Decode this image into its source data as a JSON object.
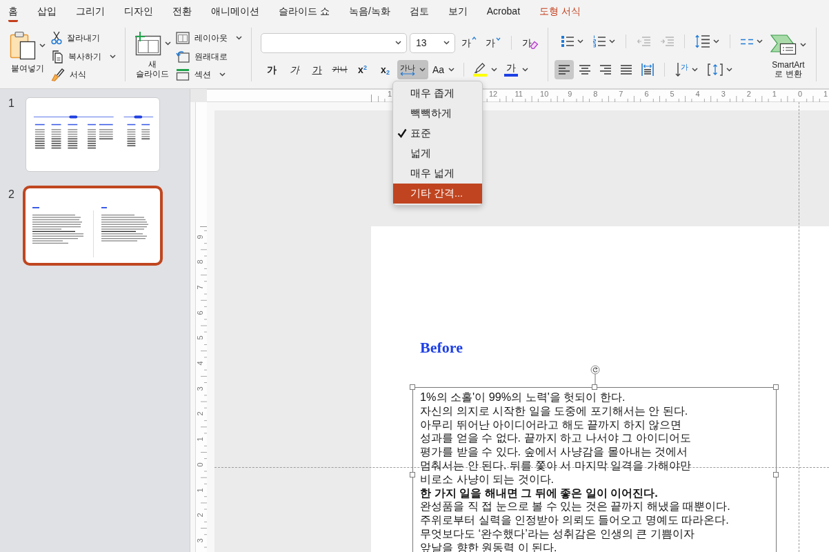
{
  "ribbon_tabs": [
    {
      "label": "홈",
      "selected": true,
      "kind": "standard"
    },
    {
      "label": "삽입",
      "selected": false,
      "kind": "standard"
    },
    {
      "label": "그리기",
      "selected": false,
      "kind": "standard"
    },
    {
      "label": "디자인",
      "selected": false,
      "kind": "standard"
    },
    {
      "label": "전환",
      "selected": false,
      "kind": "standard"
    },
    {
      "label": "애니메이션",
      "selected": false,
      "kind": "standard"
    },
    {
      "label": "슬라이드 쇼",
      "selected": false,
      "kind": "standard"
    },
    {
      "label": "녹음/녹화",
      "selected": false,
      "kind": "standard"
    },
    {
      "label": "검토",
      "selected": false,
      "kind": "standard"
    },
    {
      "label": "보기",
      "selected": false,
      "kind": "standard"
    },
    {
      "label": "Acrobat",
      "selected": false,
      "kind": "standard"
    },
    {
      "label": "도형 서식",
      "selected": false,
      "kind": "contextual"
    }
  ],
  "clipboard": {
    "paste": {
      "label": "붙여넣기",
      "dropdown": true
    },
    "tools": [
      {
        "kind": "cut",
        "label": "잘라내기",
        "dropdown": false
      },
      {
        "kind": "copy",
        "label": "복사하기",
        "dropdown": true
      },
      {
        "kind": "format_painter",
        "label": "서식",
        "dropdown": false
      }
    ]
  },
  "slides_group": {
    "new_slide": {
      "label": "새 슬라이드",
      "dropdown": true
    },
    "tools": [
      {
        "kind": "layout",
        "label": "레이아웃",
        "dropdown": true
      },
      {
        "kind": "reset",
        "label": "원래대로",
        "dropdown": false
      },
      {
        "kind": "section",
        "label": "섹션",
        "dropdown": true
      }
    ]
  },
  "font": {
    "size": "13",
    "size_buttons": [
      {
        "kind": "grow",
        "text": "가"
      },
      {
        "kind": "shrink",
        "text": "가"
      }
    ],
    "clear_formatting": {
      "text": "가"
    },
    "styles": [
      {
        "kind": "bold",
        "text": "가",
        "pressed": false,
        "dropdown": false
      },
      {
        "kind": "italic",
        "text": "가",
        "pressed": false,
        "dropdown": false
      },
      {
        "kind": "underline",
        "text": "가",
        "pressed": false,
        "dropdown": false
      },
      {
        "kind": "strikethrough",
        "text": "가나",
        "pressed": false,
        "dropdown": false
      },
      {
        "kind": "superscript",
        "text": "x$^{2}$",
        "pressed": false,
        "dropdown": false
      },
      {
        "kind": "subscript",
        "text": "x$_{2}$",
        "pressed": false,
        "dropdown": false
      },
      {
        "kind": "spacing",
        "text": "가나",
        "pressed": true,
        "dropdown": true
      },
      {
        "kind": "case",
        "text": "Aa",
        "pressed": false,
        "dropdown": true
      }
    ],
    "colors": [
      {
        "kind": "highlight",
        "color": "#ffff00"
      },
      {
        "kind": "font_color",
        "text": "가",
        "color": "#1c3fe4"
      }
    ]
  },
  "paragraph": {
    "lists": [
      {
        "kind": "bullets",
        "dropdown": true
      },
      {
        "kind": "numbering",
        "dropdown": true
      }
    ],
    "indents": [
      {
        "kind": "decrease",
        "disabled": true
      },
      {
        "kind": "increase",
        "disabled": true
      }
    ],
    "line_spacing": {
      "dropdown": true
    },
    "columns": {
      "dropdown": true
    },
    "smartart": {
      "label": "SmartArt 로 변환",
      "dropdown": true
    },
    "alignments": [
      {
        "kind": "left",
        "selected": true
      },
      {
        "kind": "center",
        "selected": false
      },
      {
        "kind": "right",
        "selected": false
      },
      {
        "kind": "justify",
        "selected": false
      },
      {
        "kind": "distributed",
        "selected": false
      }
    ],
    "text_direction": {
      "text": "가",
      "dropdown": true
    },
    "align_text": {
      "dropdown": true
    }
  },
  "slide_panel": {
    "slides": [
      {
        "number": "1",
        "kind": "table",
        "selected": false
      },
      {
        "number": "2",
        "kind": "two_column",
        "selected": true
      }
    ]
  },
  "rulers": {
    "horizontal": [
      "1",
      "12",
      "11",
      "10",
      "9",
      "8",
      "7",
      "6",
      "5",
      "4",
      "3",
      "2",
      "1",
      "0",
      "1"
    ],
    "vertical": [
      "9",
      "8",
      "7",
      "6",
      "5",
      "4",
      "3",
      "2",
      "1",
      "0",
      "1",
      "2",
      "3"
    ]
  },
  "spacing_menu": {
    "items": [
      {
        "label": "매우 좁게",
        "checked": false,
        "highlighted": false
      },
      {
        "label": "빽빽하게",
        "checked": false,
        "highlighted": false
      },
      {
        "label": "표준",
        "checked": true,
        "highlighted": false
      },
      {
        "label": "넓게",
        "checked": false,
        "highlighted": false
      },
      {
        "label": "매우 넓게",
        "checked": false,
        "highlighted": false
      },
      {
        "label": "기타 간격...",
        "checked": false,
        "highlighted": true
      }
    ]
  },
  "slide": {
    "title": "Before",
    "text_box": {
      "lines": [
        {
          "text": "1%의 소홀'이 99%의 노력'을 헛되이 한다.",
          "bold": false
        },
        {
          "text": "자신의 의지로 시작한 일을 도중에 포기해서는 안 된다.",
          "bold": false
        },
        {
          "text": "아무리 뛰어난 아이디어라고 해도 끝까지 하지 않으면",
          "bold": false
        },
        {
          "text": "성과를 얻을 수 없다. 끝까지 하고 나서야 그 아이디어도",
          "bold": false
        },
        {
          "text": "평가를 받을 수 있다. 숲에서 사냥감을 몰아내는 것에서",
          "bold": false
        },
        {
          "text": "멈춰서는 안 된다. 뒤를 쫓아 서 마지막 일격을 가해야만",
          "bold": false
        },
        {
          "text": "비로소 사냥이 되는 것이다.",
          "bold": false
        },
        {
          "text": "한 가지 일을 해내면 그 뒤에 좋은 일이 이어진다.",
          "bold": true
        },
        {
          "text": "완성품을 직 접 눈으로 볼 수 있는 것은 끝까지 해냈을 때뿐이다.",
          "bold": false
        },
        {
          "text": "주위로부터 실력을 인정받아 의뢰도 들어오고 명예도 따라온다.",
          "bold": false
        },
        {
          "text": "무엇보다도 ‘완수했다’라는 성취감은 인생의 큰 기쁨이자",
          "bold": false
        },
        {
          "text": "앞날을 향한 원동력 이 된다.",
          "bold": false
        }
      ]
    }
  }
}
